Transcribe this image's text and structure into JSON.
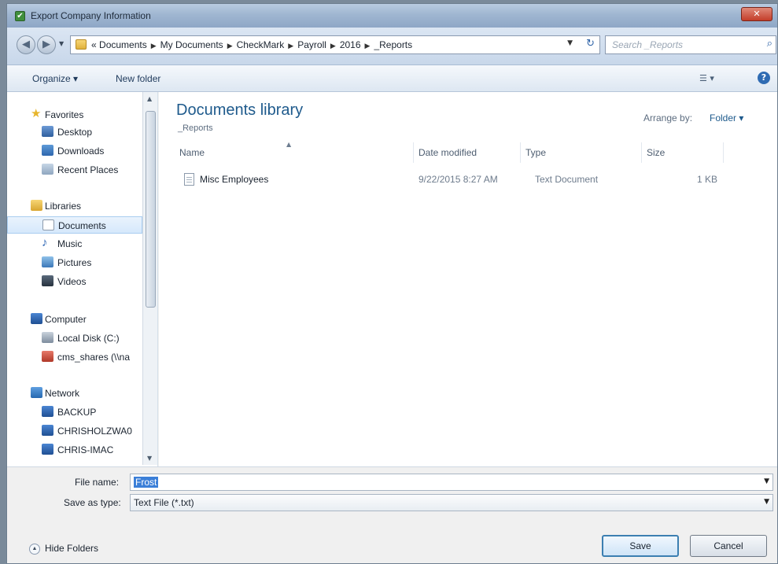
{
  "window": {
    "title": "Export Company Information",
    "close_glyph": "✕"
  },
  "nav": {
    "back_glyph": "◀",
    "forward_glyph": "▶",
    "breadcrumb_prefix": "«",
    "breadcrumbs": [
      "Documents",
      "My Documents",
      "CheckMark",
      "Payroll",
      "2016",
      "_Reports"
    ],
    "search_placeholder": "Search _Reports"
  },
  "toolbar": {
    "organize": "Organize ▾",
    "new_folder": "New folder",
    "help": "?"
  },
  "sidebar": {
    "favorites": {
      "label": "Favorites",
      "items": [
        "Desktop",
        "Downloads",
        "Recent Places"
      ]
    },
    "libraries": {
      "label": "Libraries",
      "items": [
        "Documents",
        "Music",
        "Pictures",
        "Videos"
      ]
    },
    "computer": {
      "label": "Computer",
      "items": [
        "Local Disk (C:)",
        "cms_shares (\\\\na"
      ]
    },
    "network": {
      "label": "Network",
      "items": [
        "BACKUP",
        "CHRISHOLZWA0",
        "CHRIS-IMAC"
      ]
    }
  },
  "content": {
    "title": "Documents library",
    "subtitle": "_Reports",
    "arrange_label": "Arrange by:",
    "arrange_value": "Folder ▾",
    "columns": [
      "Name",
      "Date modified",
      "Type",
      "Size"
    ],
    "rows": [
      {
        "name": "Misc Employees",
        "date": "9/22/2015 8:27 AM",
        "type": "Text Document",
        "size": "1 KB"
      }
    ]
  },
  "footer": {
    "file_name_label": "File name:",
    "file_name_value": "Frost",
    "save_type_label": "Save as type:",
    "save_type_value": "Text File (*.txt)",
    "hide_folders": "Hide Folders",
    "save": "Save",
    "cancel": "Cancel"
  },
  "colors": {
    "accent": "#1e5a8c",
    "selection": "#3b7fd8"
  }
}
